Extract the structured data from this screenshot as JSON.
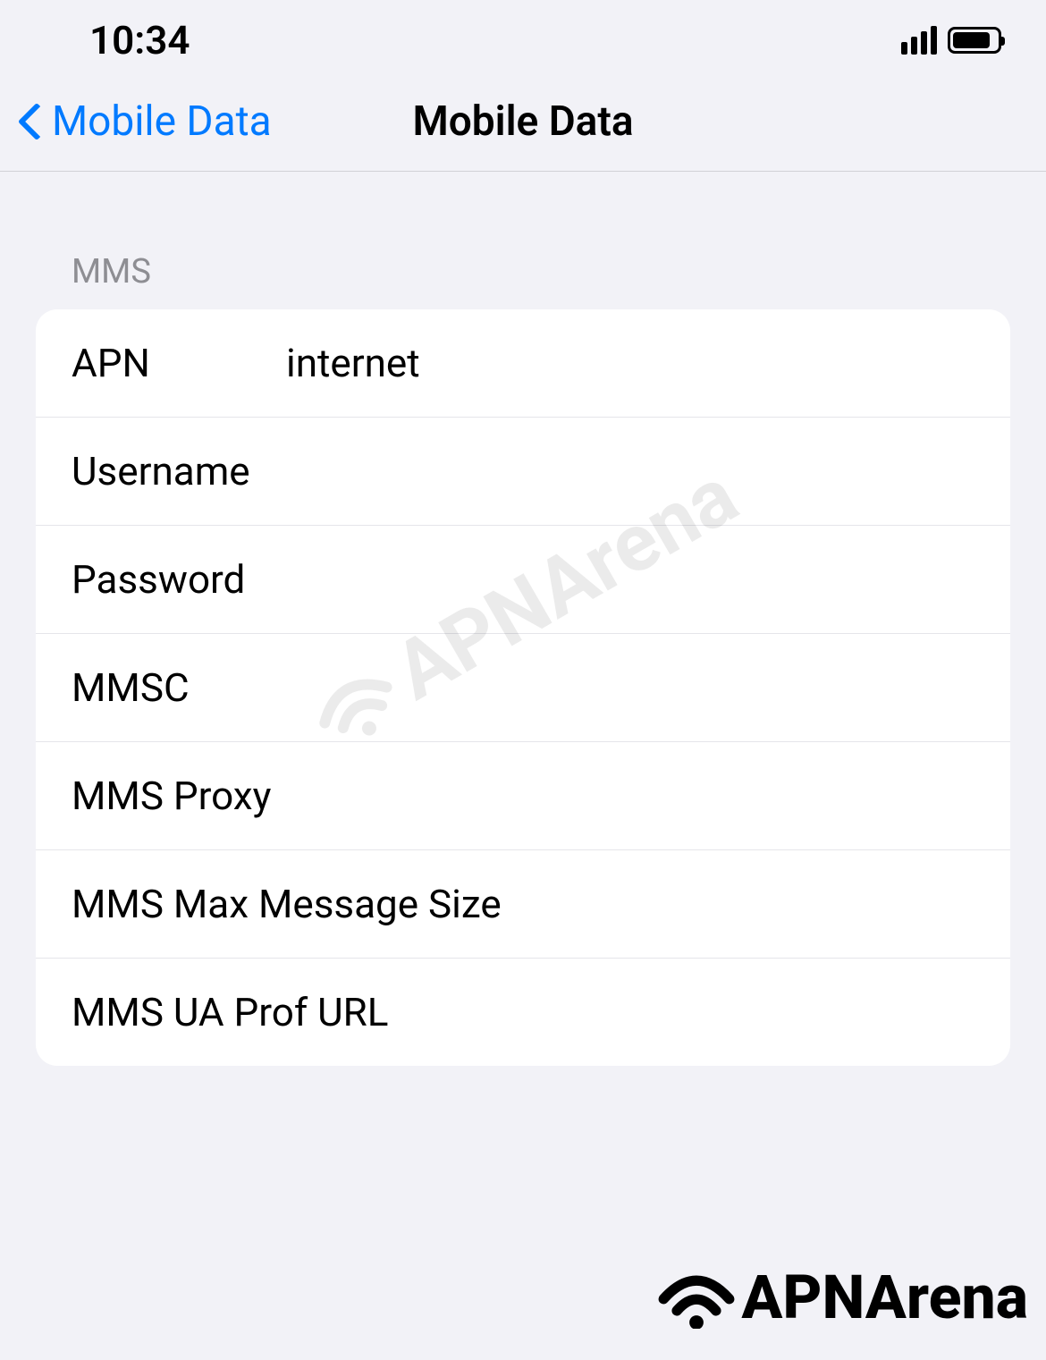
{
  "status_bar": {
    "time": "10:34"
  },
  "nav": {
    "back_label": "Mobile Data",
    "title": "Mobile Data"
  },
  "section": {
    "header": "MMS",
    "rows": [
      {
        "label": "APN",
        "value": "internet"
      },
      {
        "label": "Username",
        "value": ""
      },
      {
        "label": "Password",
        "value": ""
      },
      {
        "label": "MMSC",
        "value": ""
      },
      {
        "label": "MMS Proxy",
        "value": ""
      },
      {
        "label": "MMS Max Message Size",
        "value": ""
      },
      {
        "label": "MMS UA Prof URL",
        "value": ""
      }
    ]
  },
  "watermark": {
    "text": "APNArena"
  },
  "footer": {
    "brand": "APNArena"
  }
}
